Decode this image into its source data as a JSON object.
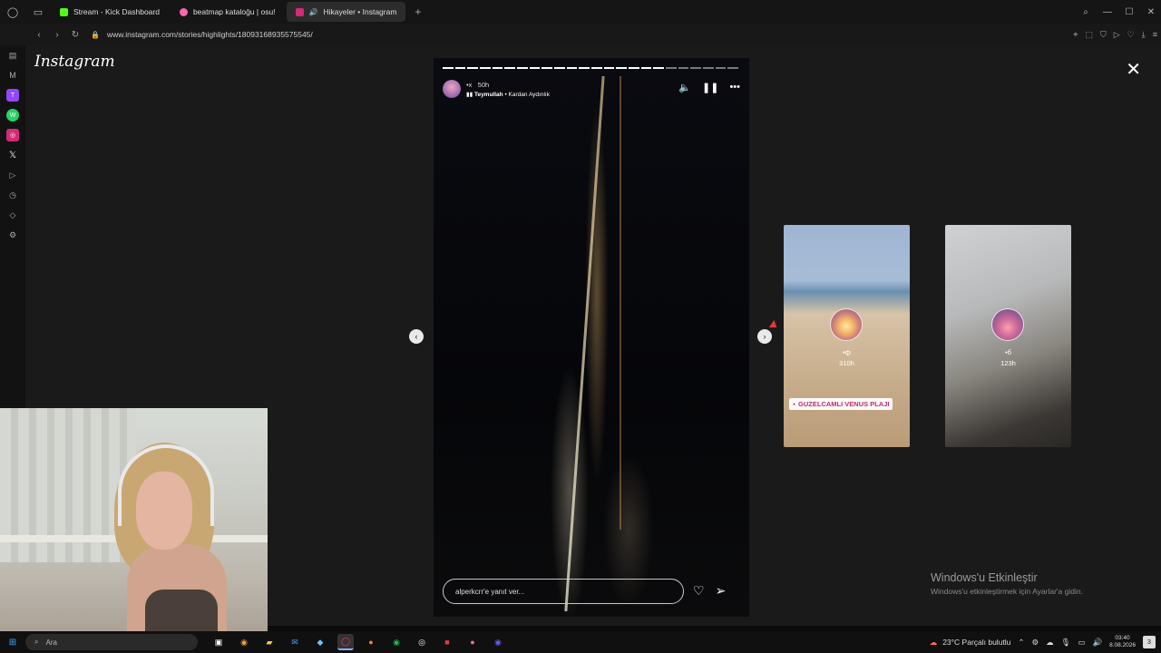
{
  "browser": {
    "tabs": [
      {
        "title": "Stream - Kick Dashboard",
        "color": "#53fc18",
        "active": false
      },
      {
        "title": "beatmap kataloğu | osu!",
        "color": "#ff66aa",
        "active": false
      },
      {
        "title": "Hikayeler • Instagram",
        "color": "#d62976",
        "active": true
      }
    ],
    "new_tab": "+",
    "url": "www.instagram.com/stories/highlights/18093168935575545/"
  },
  "instagram": {
    "logo": "Instagram",
    "story": {
      "time": "50h",
      "user_line_prefix": "•x",
      "music_user": "Teymullah",
      "music_track": "• Kardan Aydınlık",
      "progress_total": 24,
      "progress_done": 18,
      "reply_placeholder": "alperkcrr'e yanıt ver..."
    },
    "previews": [
      {
        "name": "•ф",
        "time": "310h",
        "location": "GUZELCAMLI VENUS PLAJI"
      },
      {
        "name": "•б",
        "time": "123h"
      }
    ]
  },
  "windows_activate": {
    "title": "Windows'u Etkinleştir",
    "subtitle": "Windows'u etkinleştirmek için Ayarlar'a gidin."
  },
  "taskbar": {
    "search": "Ara",
    "weather": "23°C  Parçalı bulutlu",
    "time": "03:40",
    "date": "8.08.2026",
    "notifications": "3"
  }
}
